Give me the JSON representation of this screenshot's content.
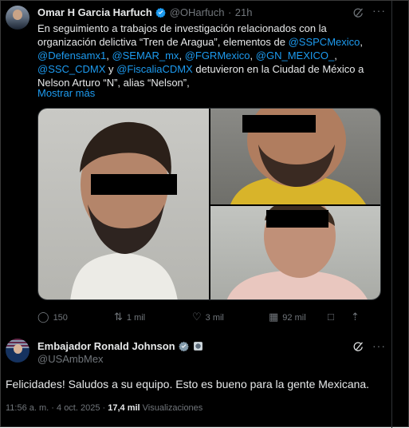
{
  "post": {
    "author_name": "Omar H Garcia Harfuch",
    "handle": "@OHarfuch",
    "separator": "·",
    "time": "21h",
    "text_1": "En seguimiento a trabajos de investigación relacionados con la organización delictiva “Tren de Aragua”, elementos de ",
    "mention_sspc": "@SSPCMexico",
    "comma": ",",
    "mention_defensa": "@Defensamx1",
    "mention_semar": "@SEMAR_mx",
    "mention_fgr": "@FGRMexico",
    "mention_gn": "@GN_MEXICO_",
    "mention_ssc": "@SSC_CDMX",
    "y": " y",
    "mention_fiscalia": "@FiscaliaCDMX",
    "text_2": " detuvieron en la Ciudad de México a Nelson Arturo “N”, alias “Nelson”,",
    "show_more": "Mostrar más",
    "stats": {
      "replies": "150",
      "reposts": "1 mil",
      "likes": "3 mil",
      "views": "92 mil"
    }
  },
  "reply": {
    "author_name": "Embajador Ronald Johnson",
    "handle": "@USAmbMex",
    "text": "Felicidades!  Saludos a su equipo. Esto es bueno para la gente Mexicana.",
    "time": "11:56 a. m.",
    "date": "4 oct. 2025",
    "dot": "·",
    "views_count": "17,4 mil",
    "views_label": "Visualizaciones"
  },
  "icons": {
    "verified": "verified-badge-icon",
    "gov_badge": "government-badge-icon",
    "grok": "grok-icon",
    "more": "more-icon",
    "reply": "reply-icon",
    "repost": "repost-icon",
    "like": "like-icon",
    "views": "views-icon",
    "bookmark": "bookmark-icon",
    "share": "share-icon"
  },
  "colors": {
    "background": "#000000",
    "text": "#e7e9ea",
    "muted": "#71767b",
    "link": "#1d9bf0"
  }
}
